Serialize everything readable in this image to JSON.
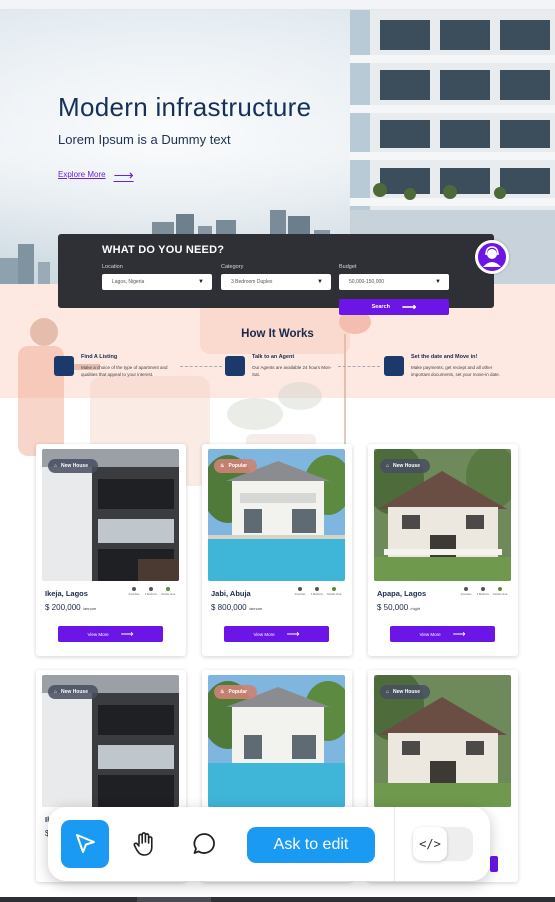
{
  "hero": {
    "title": "Modern infrastructure",
    "subtitle": "Lorem Ipsum is a Dummy text",
    "explore_link": "Explore More"
  },
  "search": {
    "heading": "WHAT DO YOU NEED?",
    "location_label": "Location",
    "location_value": "Lagos, Nigeria",
    "category_label": "Category",
    "category_value": "3 Bedroom Duplex",
    "budget_label": "Budget",
    "budget_value": "50,000-150,000",
    "search_button": "Search"
  },
  "how_it_works": {
    "title": "How It Works",
    "steps": [
      {
        "title": "Find A Listing",
        "text": "Make a choice of the type of apartment and qualities that appeal to your interest."
      },
      {
        "title": "Talk to an Agent",
        "text": "Our Agents are available 24 hours Mon-Sat."
      },
      {
        "title": "Set the date and Move in!",
        "text": "Make payments, get reciept and all other important documents, set your move-in date."
      }
    ]
  },
  "amenities": [
    "Amenities",
    "3 Bedroom",
    "Outside Area"
  ],
  "cards": [
    {
      "badge": "New House",
      "location": "Ikeja, Lagos",
      "price": "$ 200,000",
      "period": "/annum",
      "button": "View More"
    },
    {
      "badge": "Popular",
      "location": "Jabi, Abuja",
      "price": "$ 800,000",
      "period": "/annum",
      "button": "View More"
    },
    {
      "badge": "New House",
      "location": "Apapa, Lagos",
      "price": "$ 50,000",
      "period": "/night",
      "button": "View More"
    },
    {
      "badge": "New House",
      "location": "Ik",
      "price": "$",
      "period": "",
      "button": ""
    },
    {
      "badge": "Popular",
      "location": "",
      "price": "",
      "period": "",
      "button": ""
    },
    {
      "badge": "New House",
      "location": "",
      "price": "",
      "period": "",
      "button": ""
    }
  ],
  "toolbar": {
    "ask_label": "Ask to edit",
    "code_label": "</>"
  },
  "colors": {
    "accent": "#6b16e6",
    "navy": "#15305a",
    "toolbar_blue": "#1a9af3",
    "how_band": "#fde8e2"
  }
}
